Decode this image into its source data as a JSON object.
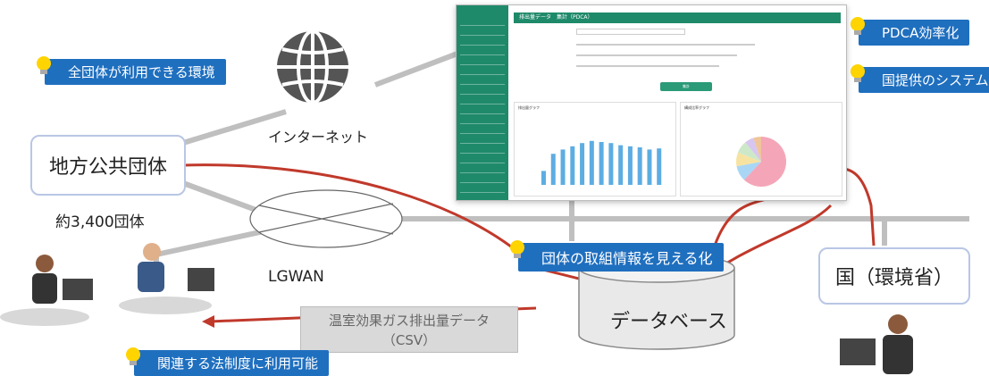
{
  "entities": {
    "local_gov": "地方公共団体",
    "local_gov_count": "約3,400団体",
    "national": "国（環境省）",
    "database": "データベース",
    "internet": "インターネット",
    "lgwan": "LGWAN"
  },
  "csv_box": {
    "line1": "温室効果ガス排出量データ",
    "line2": "（CSV）"
  },
  "callouts": {
    "all_orgs": "全団体が利用できる環境",
    "pdca": "PDCA効率化",
    "national_system": "国提供のシステム",
    "visualize": "団体の取組情報を見える化",
    "legal": "関連する法制度に利用可能"
  },
  "colors": {
    "callout_bg": "#1f6fbf",
    "arrow": "#c0392b",
    "box_border": "#b9c6e4",
    "app_green": "#1f8a6a"
  },
  "app_screenshot": {
    "header_title": "排出量データ　集計（PDCA）",
    "submit_label": "集計",
    "bar_panel_title": "排出量グラフ",
    "pie_panel_title": "構成比率グラフ"
  },
  "chart_data": [
    {
      "type": "bar",
      "values": [
        26,
        58,
        66,
        72,
        78,
        82,
        80,
        78,
        74,
        72,
        70,
        66,
        68
      ]
    },
    {
      "type": "pie",
      "values": [
        62,
        10,
        9,
        8,
        6,
        5
      ]
    }
  ]
}
